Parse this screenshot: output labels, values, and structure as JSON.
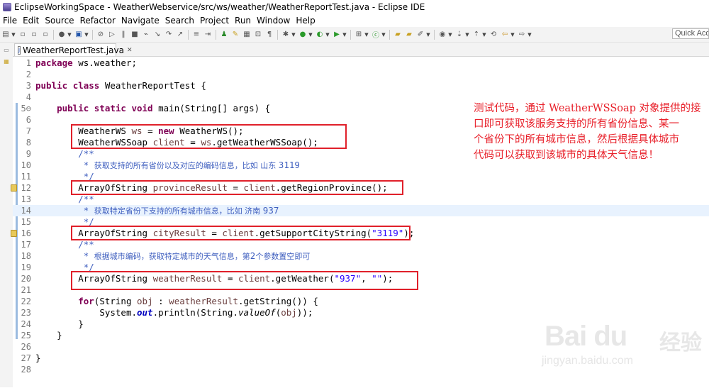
{
  "window": {
    "title": "EclipseWorkingSpace - WeatherWebservice/src/ws/weather/WeatherReportTest.java - Eclipse IDE"
  },
  "menu": [
    "File",
    "Edit",
    "Source",
    "Refactor",
    "Navigate",
    "Search",
    "Project",
    "Run",
    "Window",
    "Help"
  ],
  "toolbar": {
    "quick_access": "Quick Access"
  },
  "editor": {
    "tab_label": "WeatherReportTest.java",
    "tab_close": "✕",
    "line_numbers": [
      "1",
      "2",
      "3",
      "4",
      "5⊖",
      "6",
      "7",
      "8",
      "9",
      "10",
      "11",
      "12",
      "13",
      "14",
      "15",
      "16",
      "17",
      "18",
      "19",
      "20",
      "21",
      "22",
      "23",
      "24",
      "25",
      "26",
      "27",
      "28"
    ],
    "code": {
      "pkg_name": " ws.weather;",
      "class_name": " WeatherReportTest {",
      "main_sig": "(String[] args) {",
      "l7_type": "WeatherWS ",
      "l7_var": "ws",
      "l7_eq": " = ",
      "l7_new": "WeatherWS();",
      "l8_type": "WeatherWSSoap ",
      "l8_var": "client",
      "l8_eq": " = ",
      "l8_var2": "ws",
      "l8_call": ".getWeatherWSSoap();",
      "c9": "/**",
      "c10_text": "获取支持的所有省份以及对应的编码信息，比如 山东 ",
      "c10_num": "3119",
      "c11": " */",
      "l12_type": "ArrayOfString ",
      "l12_var": "provinceResult",
      "l12_eq": " = ",
      "l12_var2": "client",
      "l12_call": ".getRegionProvince();",
      "c13": "/**",
      "c14_text": "获取特定省份下支持的所有城市信息，比如 济南 ",
      "c14_num": "937",
      "c15": " */",
      "l16_type": "ArrayOfString ",
      "l16_var": "cityResult",
      "l16_eq": " = ",
      "l16_var2": "client",
      "l16_call": ".getSupportCityString(",
      "l16_str": "\"3119\"",
      "l16_end": ");",
      "c17": "/**",
      "c18_text": "根据城市编码，获取特定城市的天气信息，第",
      "c18_num": "2",
      "c18_text2": "个参数置空即可",
      "c19": " */",
      "l20_type": "ArrayOfString ",
      "l20_var": "weatherResult",
      "l20_eq": " = ",
      "l20_var2": "client",
      "l20_call": ".getWeather(",
      "l20_str1": "\"937\"",
      "l20_comma": ", ",
      "l20_str2": "\"\"",
      "l20_end": ");",
      "l22_for": "for",
      "l22_a": "(String ",
      "l22_var": "obj",
      "l22_b": " : ",
      "l22_var2": "weatherResult",
      "l22_c": ".getString()) {",
      "l23_a": "System.",
      "l23_out": "out",
      "l23_b": ".println(String.",
      "l23_valueOf": "valueOf",
      "l23_c": "(",
      "l23_var": "obj",
      "l23_d": "));",
      "l24": "}",
      "l25": "}",
      "l27": "}"
    },
    "keywords": {
      "package": "package",
      "public": "public",
      "class": "class",
      "static": "static",
      "void": "void",
      "main": " main",
      "new": "new"
    }
  },
  "annotation": [
    "测试代码，通过 WeatherWSSoap 对象提供的接",
    "口即可获取该服务支持的所有省份信息、某一",
    "个省份下的所有城市信息，然后根据具体城市",
    "代码可以获取到该城市的具体天气信息！"
  ],
  "watermark": {
    "brand": "Bai du",
    "brand_cn": "经验",
    "url": "jingyan.baidu.com"
  },
  "colors": {
    "keyword": "#7f0055",
    "string": "#2a00ff",
    "comment": "#3f5fbf",
    "local_var": "#6a3e3e",
    "highlight_box": "#e0202a",
    "annotation": "#e8202a"
  }
}
